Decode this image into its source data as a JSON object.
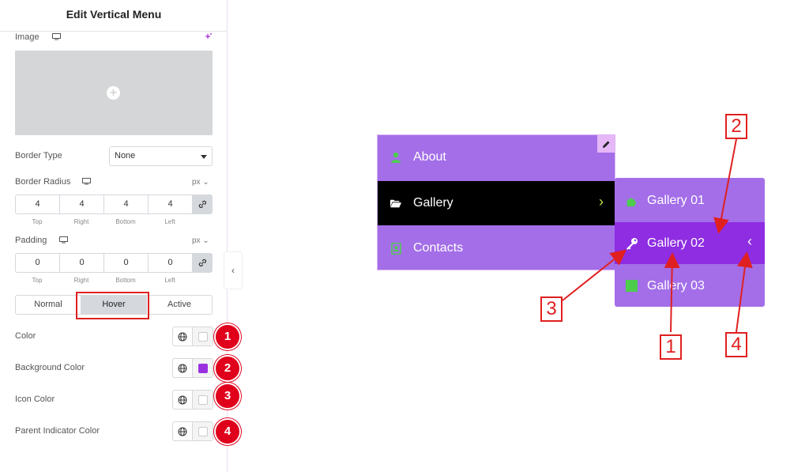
{
  "panel": {
    "title": "Edit Vertical Menu",
    "image_label": "Image",
    "border_type_label": "Border Type",
    "border_type_value": "None",
    "border_radius_label": "Border Radius",
    "border_radius_unit": "px",
    "border_radius": {
      "top": "4",
      "right": "4",
      "bottom": "4",
      "left": "4"
    },
    "padding_label": "Padding",
    "padding_unit": "px",
    "padding": {
      "top": "0",
      "right": "0",
      "bottom": "0",
      "left": "0"
    },
    "dim_labels": {
      "top": "Top",
      "right": "Right",
      "bottom": "Bottom",
      "left": "Left"
    },
    "tabs": [
      "Normal",
      "Hover",
      "Active"
    ],
    "active_tab": "Hover",
    "controls": [
      {
        "label": "Color",
        "swatch": "#ffffff",
        "badge": "1"
      },
      {
        "label": "Background Color",
        "swatch": "#9b30e0",
        "badge": "2"
      },
      {
        "label": "Icon Color",
        "swatch": "#ffffff",
        "badge": "3"
      },
      {
        "label": "Parent Indicator Color",
        "swatch": "#ffffff",
        "badge": "4"
      }
    ]
  },
  "menu": {
    "items": [
      {
        "label": "About",
        "icon": "user-icon",
        "bg": "#a36ee8",
        "icon_color": "#4cce4c"
      },
      {
        "label": "Gallery",
        "icon": "folder-open-icon",
        "bg": "#000000",
        "icon_color": "#ffffff",
        "indicator": "›",
        "indicator_color": "#c4e84a"
      },
      {
        "label": "Contacts",
        "icon": "contact-book-icon",
        "bg": "#a36ee8",
        "icon_color": "#4cce4c"
      }
    ],
    "submenu": [
      {
        "label": "Gallery 01",
        "icon": "puzzle-icon"
      },
      {
        "label": "Gallery 02",
        "icon": "key-icon",
        "indicator": "‹"
      },
      {
        "label": "Gallery 03",
        "icon": "square-icon"
      }
    ]
  },
  "annotations": [
    "1",
    "2",
    "3",
    "4"
  ],
  "colors": {
    "accent": "#a36ee8",
    "hover_bg": "#8e2de2",
    "badge_red": "#e0001b",
    "arrow_red": "#e02020"
  }
}
